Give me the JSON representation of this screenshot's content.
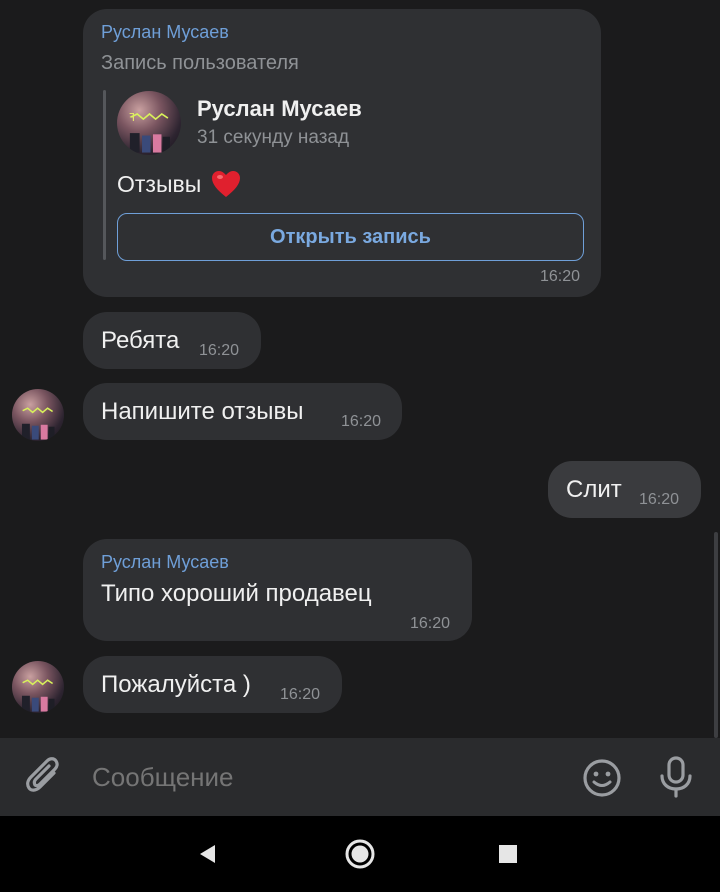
{
  "repost": {
    "sender": "Руслан Мусаев",
    "caption": "Запись пользователя",
    "author": "Руслан Мусаев",
    "posted_ago": "31 секунду назад",
    "post_text": "Отзывы",
    "emoji": "❤️",
    "open_button": "Открыть запись",
    "time": "16:20"
  },
  "messages": [
    {
      "text": "Ребята",
      "time": "16:20"
    },
    {
      "text": "Напишите отзывы",
      "time": "16:20"
    },
    {
      "text": "Слит",
      "time": "16:20"
    },
    {
      "sender": "Руслан Мусаев",
      "text": "Типо хороший продавец",
      "time": "16:20"
    },
    {
      "text": "Пожалуйста )",
      "time": "16:20"
    }
  ],
  "composer": {
    "placeholder": "Сообщение",
    "attach_icon": "paperclip-icon",
    "emoji_icon": "smiley-icon",
    "mic_icon": "microphone-icon"
  },
  "nav": {
    "back_icon": "back-triangle-icon",
    "home_icon": "home-circle-icon",
    "recents_icon": "recents-square-icon"
  },
  "colors": {
    "background": "#1b1b1c",
    "bubble_in": "#2f3033",
    "bubble_out": "#3a3b3e",
    "accent": "#6f9fd8",
    "heart": "#e0202e"
  }
}
